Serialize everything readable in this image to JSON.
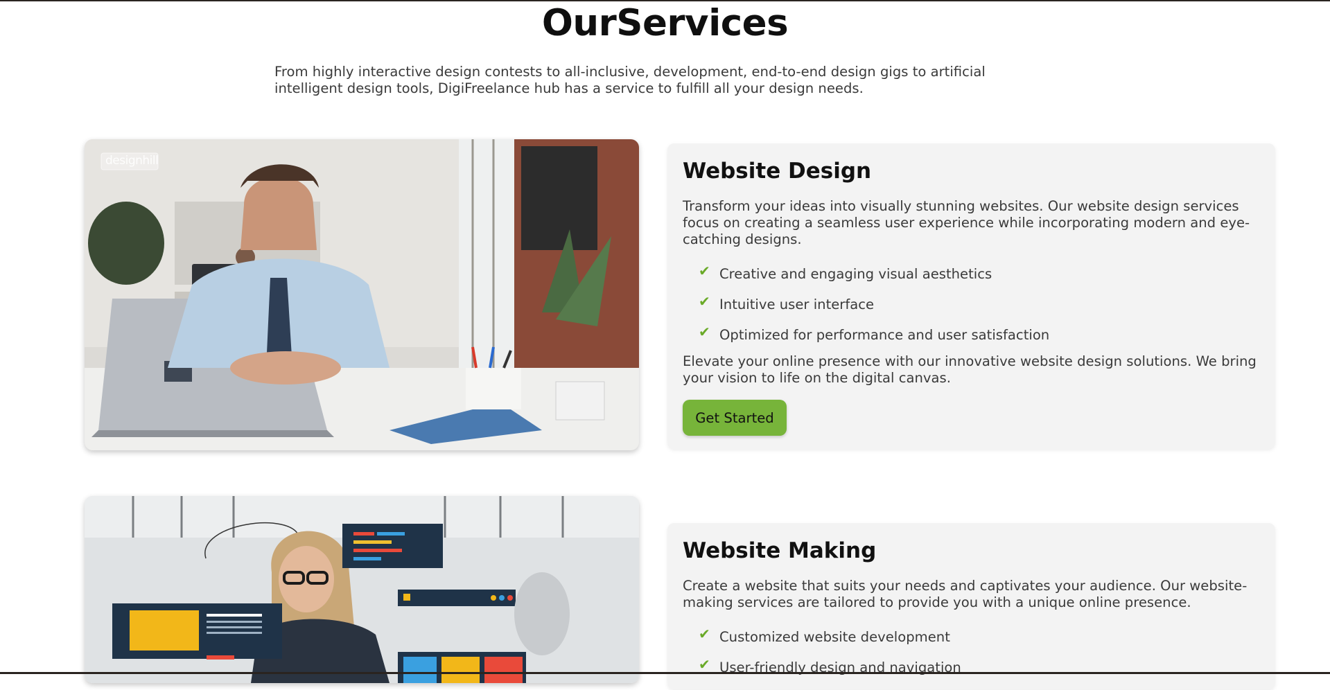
{
  "page": {
    "title": "OurServices",
    "intro": "From highly interactive design contests to all-inclusive, development, end-to-end design gigs to artificial intelligent design tools, DigiFreelance hub has a service to fulfill all your design needs."
  },
  "services": [
    {
      "title": "Website Design",
      "description": "Transform your ideas into visually stunning websites. Our website design services focus on creating a seamless user experience while incorporating modern and eye-catching designs.",
      "features": [
        "Creative and engaging visual aesthetics",
        "Intuitive user interface",
        "Optimized for performance and user satisfaction"
      ],
      "outro": "Elevate your online presence with our innovative website design solutions. We bring your vision to life on the digital canvas.",
      "cta_label": "Get Started",
      "image_watermark": "designhill"
    },
    {
      "title": "Website Making",
      "description": "Create a website that suits your needs and captivates your audience. Our website-making services are tailored to provide you with a unique online presence.",
      "features": [
        "Customized website development",
        "User-friendly design and navigation"
      ]
    }
  ],
  "colors": {
    "accent_green": "#77b43a",
    "check_green": "#6aaa28",
    "card_background": "#f3f3f3"
  },
  "icons": {
    "feature_bullet": "check-icon"
  }
}
